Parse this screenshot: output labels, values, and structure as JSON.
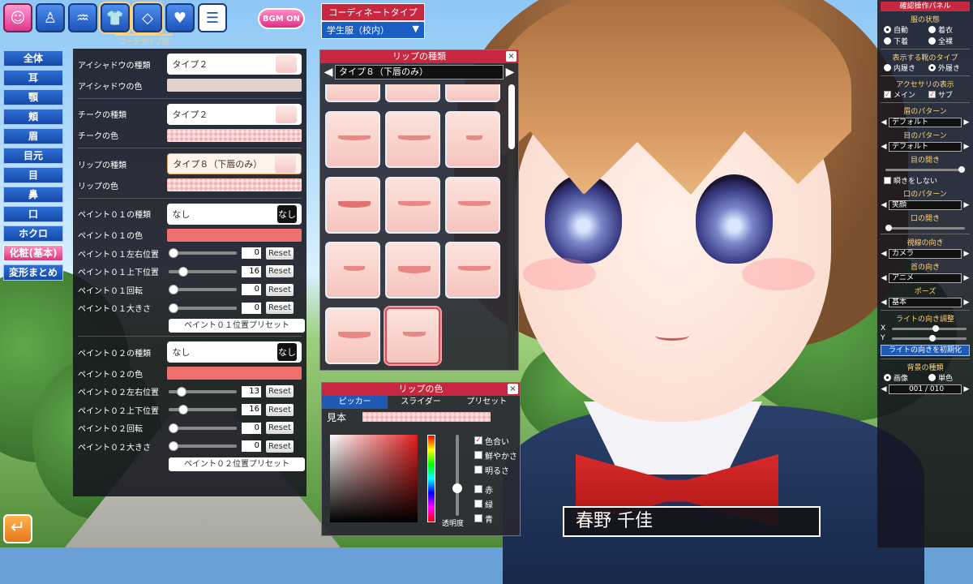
{
  "toolbar": {
    "buttons": [
      {
        "icon": "face-icon"
      },
      {
        "icon": "body-icon"
      },
      {
        "icon": "hair-icon"
      },
      {
        "icon": "shirt-icon"
      },
      {
        "icon": "diamond-icon"
      },
      {
        "icon": "heart-icon"
      },
      {
        "icon": "document-icon"
      }
    ],
    "bgm_label": "BGM ON",
    "coord_tab_label": "コーデタイプ別"
  },
  "coordinate_type": {
    "header": "コーディネートタイプ",
    "value": "学生服（校内）"
  },
  "categories": [
    {
      "label": "全体"
    },
    {
      "label": "耳"
    },
    {
      "label": "顎"
    },
    {
      "label": "頬"
    },
    {
      "label": "眉"
    },
    {
      "label": "目元"
    },
    {
      "label": "目"
    },
    {
      "label": "鼻"
    },
    {
      "label": "口"
    },
    {
      "label": "ホクロ"
    },
    {
      "label": "化粧(基本)",
      "active": true
    },
    {
      "label": "変形まとめ"
    }
  ],
  "makeup": {
    "eyeshadow_type_label": "アイシャドウの種類",
    "eyeshadow_type_value": "タイプ２",
    "eyeshadow_color_label": "アイシャドウの色",
    "cheek_type_label": "チークの種類",
    "cheek_type_value": "タイプ２",
    "cheek_color_label": "チークの色",
    "lip_type_label": "リップの種類",
    "lip_type_value": "タイプ８（下唇のみ）",
    "lip_color_label": "リップの色",
    "paint01_type_label": "ペイント０１の種類",
    "paint01_type_value": "なし",
    "paint01_type_badge": "なし",
    "paint01_color_label": "ペイント０１の色",
    "paint01_sliders": [
      {
        "label": "ペイント０１左右位置",
        "value": "0",
        "fraction": 0.0
      },
      {
        "label": "ペイント０１上下位置",
        "value": "16",
        "fraction": 0.16
      },
      {
        "label": "ペイント０１回転",
        "value": "0",
        "fraction": 0.0
      },
      {
        "label": "ペイント０１大きさ",
        "value": "0",
        "fraction": 0.0
      }
    ],
    "paint01_preset": "ペイント０１位置プリセット",
    "paint02_type_label": "ペイント０２の種類",
    "paint02_type_value": "なし",
    "paint02_type_badge": "なし",
    "paint02_color_label": "ペイント０２の色",
    "paint02_sliders": [
      {
        "label": "ペイント０２左右位置",
        "value": "13",
        "fraction": 0.13
      },
      {
        "label": "ペイント０２上下位置",
        "value": "16",
        "fraction": 0.16
      },
      {
        "label": "ペイント０２回転",
        "value": "0",
        "fraction": 0.0
      },
      {
        "label": "ペイント０２大きさ",
        "value": "0",
        "fraction": 0.0
      }
    ],
    "paint02_preset": "ペイント０２位置プリセット",
    "reset_label": "Reset"
  },
  "lip_panel": {
    "title": "リップの種類",
    "current": "タイプ８（下唇のみ）",
    "prev": "◀",
    "next": "▶",
    "close": "×"
  },
  "color_panel": {
    "title": "リップの色",
    "close": "×",
    "tabs": [
      "ピッカー",
      "スライダー",
      "プリセット"
    ],
    "sample_label": "見本",
    "alpha_label": "透明度",
    "options": [
      {
        "label": "色合い",
        "checked": true
      },
      {
        "label": "鮮やかさ",
        "checked": false
      },
      {
        "label": "明るさ",
        "checked": false
      },
      {
        "label": "赤",
        "checked": false
      },
      {
        "label": "緑",
        "checked": false
      },
      {
        "label": "青",
        "checked": false
      }
    ]
  },
  "nameplate": {
    "name": "春野 千佳"
  },
  "right_panel": {
    "title": "確認操作パネル",
    "clothes_state_label": "服の状態",
    "clothes_state": [
      {
        "label": "自動",
        "on": true
      },
      {
        "label": "着衣",
        "on": false
      },
      {
        "label": "下着",
        "on": false
      },
      {
        "label": "全裸",
        "on": false
      }
    ],
    "shoes_label": "表示する靴のタイプ",
    "shoes": [
      {
        "label": "内履き",
        "on": false
      },
      {
        "label": "外履き",
        "on": true
      }
    ],
    "accessory_label": "アクセサリの表示",
    "accessory": [
      {
        "label": "メイン",
        "checked": true
      },
      {
        "label": "サブ",
        "checked": true
      }
    ],
    "brow_pattern_label": "眉のパターン",
    "brow_pattern_value": "デフォルト",
    "eye_pattern_label": "目のパターン",
    "eye_pattern_value": "デフォルト",
    "eye_open_label": "目の開き",
    "eye_open_fraction": 1.0,
    "no_blink_label": "瞬きをしない",
    "mouth_pattern_label": "口のパターン",
    "mouth_pattern_value": "笑顔",
    "mouth_open_label": "口の開き",
    "mouth_open_fraction": 0.0,
    "gaze_label": "視線の向き",
    "gaze_value": "カメラ",
    "neck_label": "首の向き",
    "neck_value": "アニメ",
    "pose_label": "ポーズ",
    "pose_value": "基本",
    "light_label": "ライトの向き調整",
    "light_x_label": "X",
    "light_x_fraction": 0.6,
    "light_y_label": "Y",
    "light_y_fraction": 0.55,
    "light_reset": "ライトの向きを初期化",
    "bg_label": "背景の種類",
    "bg_options": [
      {
        "label": "画像",
        "on": true
      },
      {
        "label": "単色",
        "on": false
      }
    ],
    "bg_value": "001 / 010",
    "left_arrow": "◀",
    "right_arrow": "▶"
  },
  "back_icon": "return-arrow-icon"
}
